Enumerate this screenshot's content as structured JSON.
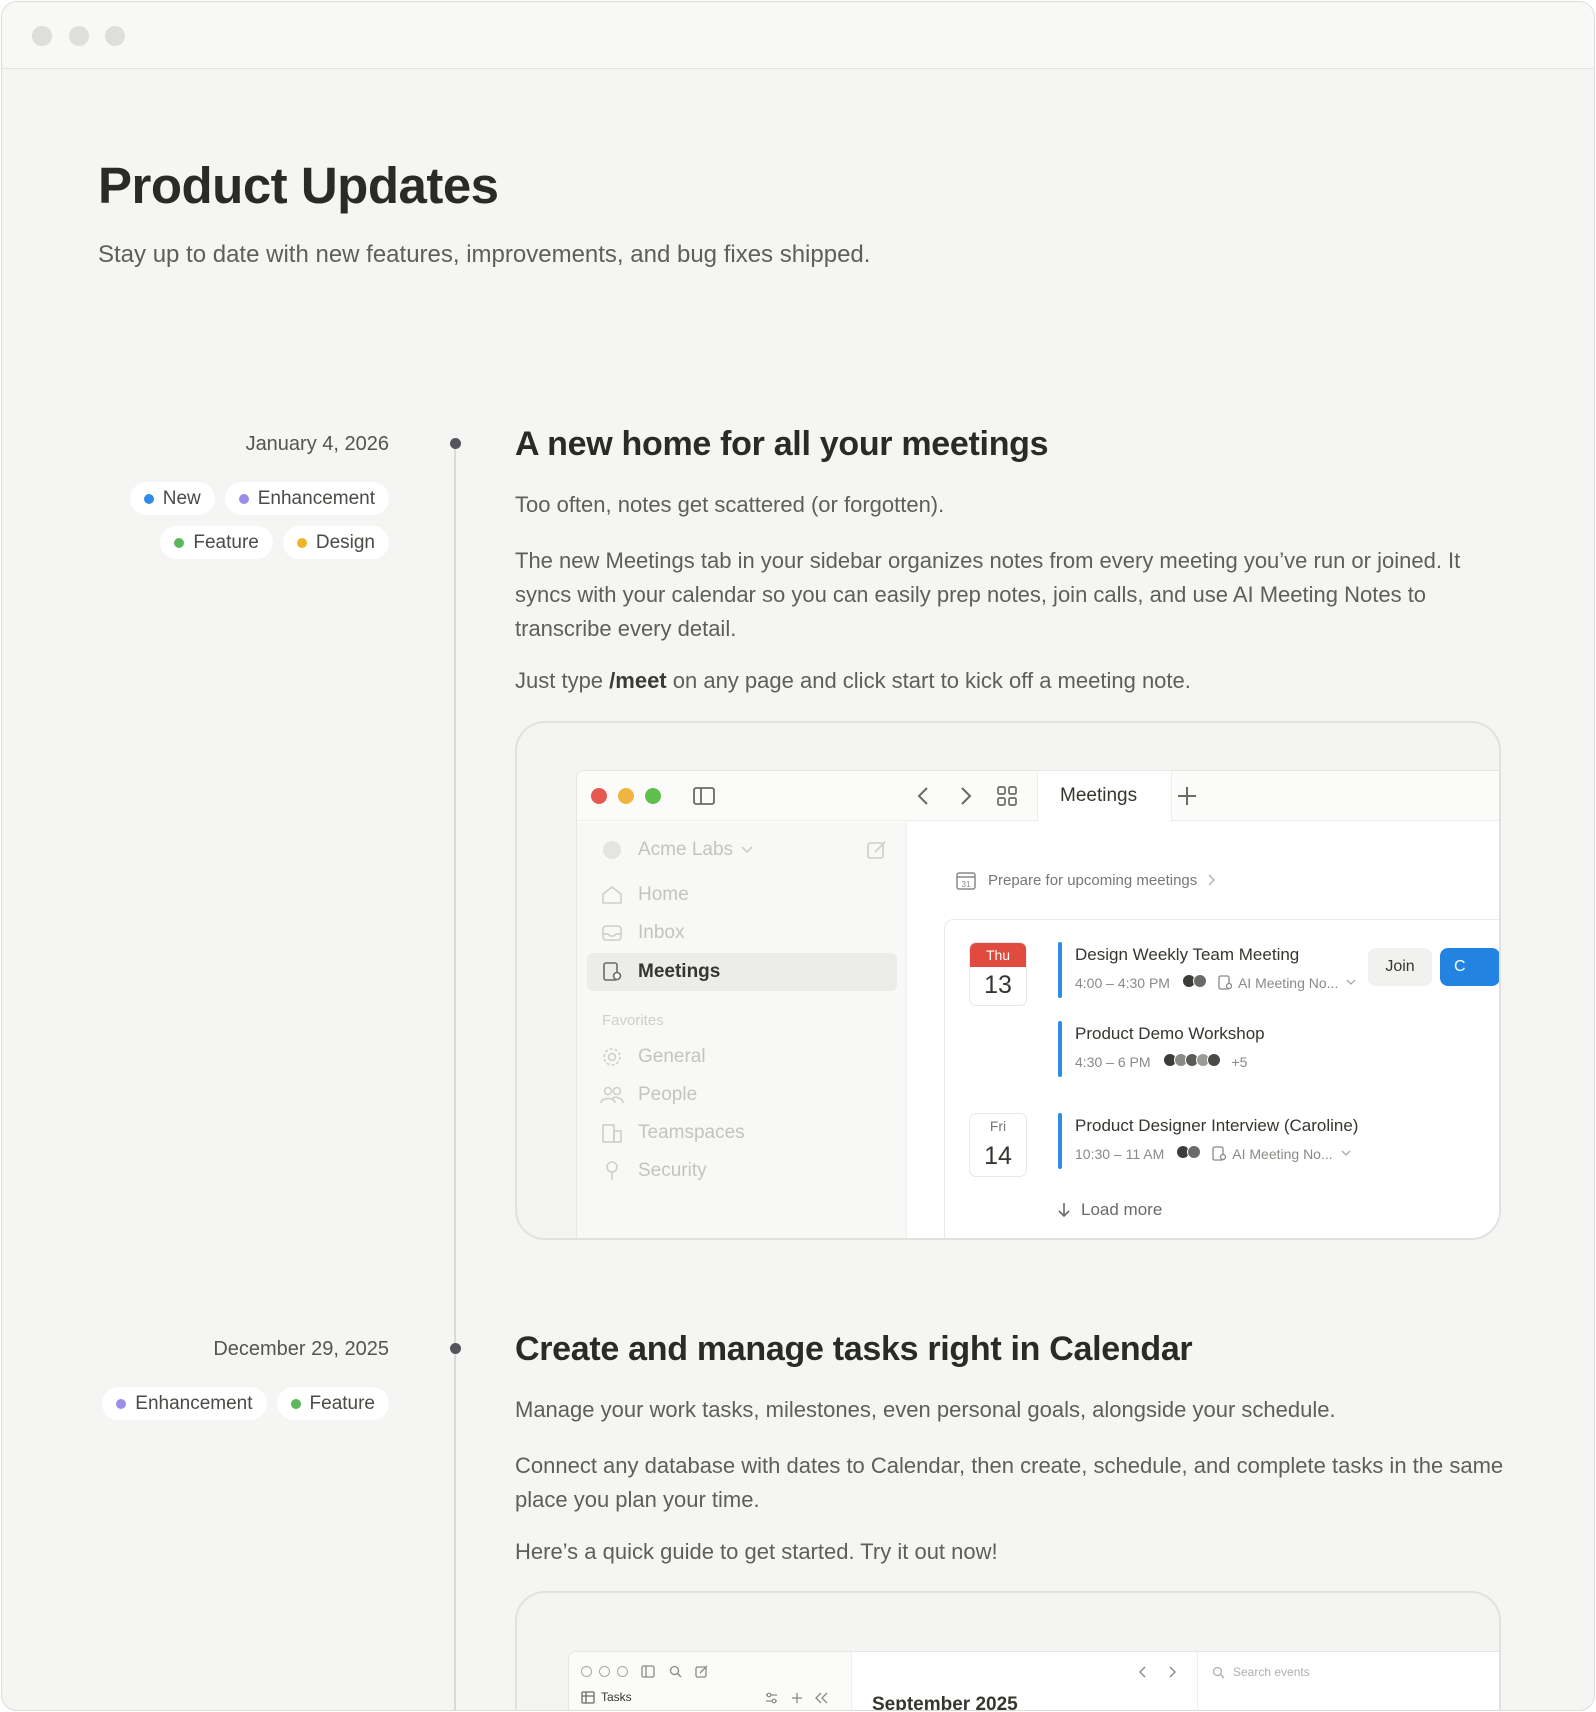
{
  "page": {
    "title": "Product Updates",
    "subtitle": "Stay up to date with new features, improvements, and bug fixes shipped."
  },
  "tag_colors": {
    "New": "#2f8ce6",
    "Enhancement": "#9b8ee8",
    "Feature": "#5cb85c",
    "Design": "#f0b429"
  },
  "entries": [
    {
      "date": "January 4, 2026",
      "tags_row1": [
        "New",
        "Enhancement"
      ],
      "tags_row2": [
        "Feature",
        "Design"
      ],
      "title": "A new home for all your meetings",
      "para1": "Too often, notes get scattered (or forgotten).",
      "para2": "The new Meetings tab in your sidebar organizes notes from every meeting you’ve run or joined. It syncs with your calendar so you can easily prep notes, join calls, and use AI Meeting Notes to transcribe every detail.",
      "para3_prefix": "Just type ",
      "para3_command": "/meet",
      "para3_suffix": " on any page and click start to kick off a meeting note.",
      "screenshot": {
        "tab_label": "Meetings",
        "workspace": "Acme Labs",
        "sidebar": {
          "home": "Home",
          "inbox": "Inbox",
          "meetings": "Meetings",
          "favorites_header": "Favorites",
          "general": "General",
          "people": "People",
          "teamspaces": "Teamspaces",
          "security": "Security"
        },
        "prep_link": "Prepare for upcoming meetings",
        "days": [
          {
            "dow": "Thu",
            "num": "13"
          },
          {
            "dow": "Fri",
            "num": "14"
          }
        ],
        "events": [
          {
            "title": "Design Weekly Team Meeting",
            "time": "4:00 – 4:30 PM",
            "note": "AI Meeting No..."
          },
          {
            "title": "Product Demo Workshop",
            "time": "4:30 – 6 PM",
            "extra": "+5"
          },
          {
            "title": "Product Designer Interview (Caroline)",
            "time": "10:30 – 11 AM",
            "note": "AI Meeting No..."
          }
        ],
        "join_label": "Join",
        "blue_button_label": "C",
        "load_more": "Load more",
        "calendar_date_icon": "31"
      }
    },
    {
      "date": "December 29, 2025",
      "tags_row1": [
        "Enhancement",
        "Feature"
      ],
      "title": "Create and manage tasks right in Calendar",
      "para1": "Manage your work tasks, milestones, even personal goals, alongside your schedule.",
      "para2": "Connect any database with dates to Calendar, then create, schedule, and complete tasks in the same place you plan your time.",
      "para3": "Here’s a quick guide to get started. Try it out now!",
      "screenshot": {
        "sidebar_item": "Tasks",
        "search_placeholder": "Search events",
        "month": "September 2025"
      }
    }
  ]
}
